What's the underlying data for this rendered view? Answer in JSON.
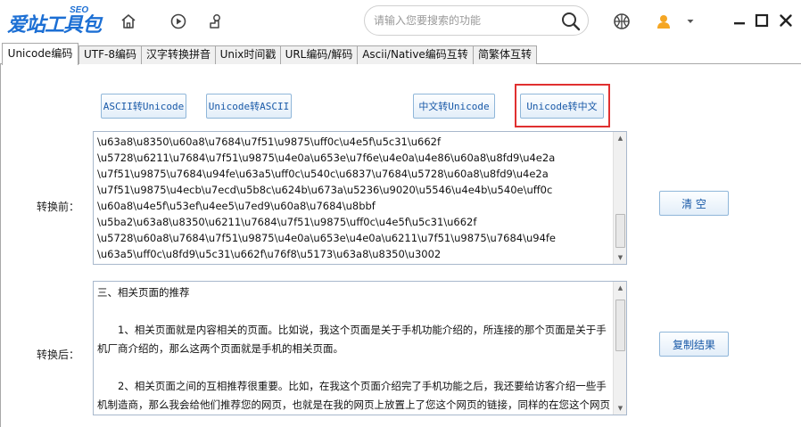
{
  "app": {
    "logo_text": "爱站工具包",
    "logo_badge": "SEO",
    "accent_color": "#1c6fd4"
  },
  "toolbar": {
    "icons": [
      "home-icon",
      "play-icon",
      "puzzle-icon"
    ],
    "search_placeholder": "请输入您要搜索的功能"
  },
  "tabs": [
    {
      "label": "Unicode编码",
      "active": true
    },
    {
      "label": "UTF-8编码",
      "active": false
    },
    {
      "label": "汉字转换拼音",
      "active": false
    },
    {
      "label": "Unix时间戳",
      "active": false
    },
    {
      "label": "URL编码/解码",
      "active": false
    },
    {
      "label": "Ascii/Native编码互转",
      "active": false
    },
    {
      "label": "简繁体互转",
      "active": false
    }
  ],
  "buttons": {
    "ascii_to_unicode": "ASCII转Unicode",
    "unicode_to_ascii": "Unicode转ASCII",
    "chinese_to_unicode": "中文转Unicode",
    "unicode_to_chinese": "Unicode转中文",
    "clear": "清 空",
    "copy_result": "复制结果"
  },
  "labels": {
    "before": "转换前：",
    "after": "转换后："
  },
  "input_text": "\\u63a8\\u8350\\u60a8\\u7684\\u7f51\\u9875\\uff0c\\u4e5f\\u5c31\\u662f\n\\u5728\\u6211\\u7684\\u7f51\\u9875\\u4e0a\\u653e\\u7f6e\\u4e0a\\u4e86\\u60a8\\u8fd9\\u4e2a\n\\u7f51\\u9875\\u7684\\u94fe\\u63a5\\uff0c\\u540c\\u6837\\u7684\\u5728\\u60a8\\u8fd9\\u4e2a\n\\u7f51\\u9875\\u4ecb\\u7ecd\\u5b8c\\u624b\\u673a\\u5236\\u9020\\u5546\\u4e4b\\u540e\\uff0c\n\\u60a8\\u4e5f\\u53ef\\u4ee5\\u7ed9\\u60a8\\u7684\\u8bbf\n\\u5ba2\\u63a8\\u8350\\u6211\\u7684\\u7f51\\u9875\\uff0c\\u4e5f\\u5c31\\u662f\n\\u5728\\u60a8\\u7684\\u7f51\\u9875\\u4e0a\\u653e\\u4e0a\\u6211\\u7f51\\u9875\\u7684\\u94fe\n\\u63a5\\uff0c\\u8fd9\\u5c31\\u662f\\u76f8\\u5173\\u63a8\\u8350\\u3002",
  "output_text": "三、相关页面的推荐\n\n　　1、相关页面就是内容相关的页面。比如说，我这个页面是关于手机功能介绍的，所连接的那个页面是关于手机厂商介绍的，那么这两个页面就是手机的相关页面。\n\n　　2、相关页面之间的互相推荐很重要。比如，在我这个页面介绍完了手机功能之后，我还要给访客介绍一些手机制造商，那么我会给他们推荐您的网页，也就是在我的网页上放置上了您这个网页的链接，同样的在您这个网页介绍完手机制造商之后，您也可以给您的访客推荐我的网页，也就是在您的网页上放上我网页的"
}
